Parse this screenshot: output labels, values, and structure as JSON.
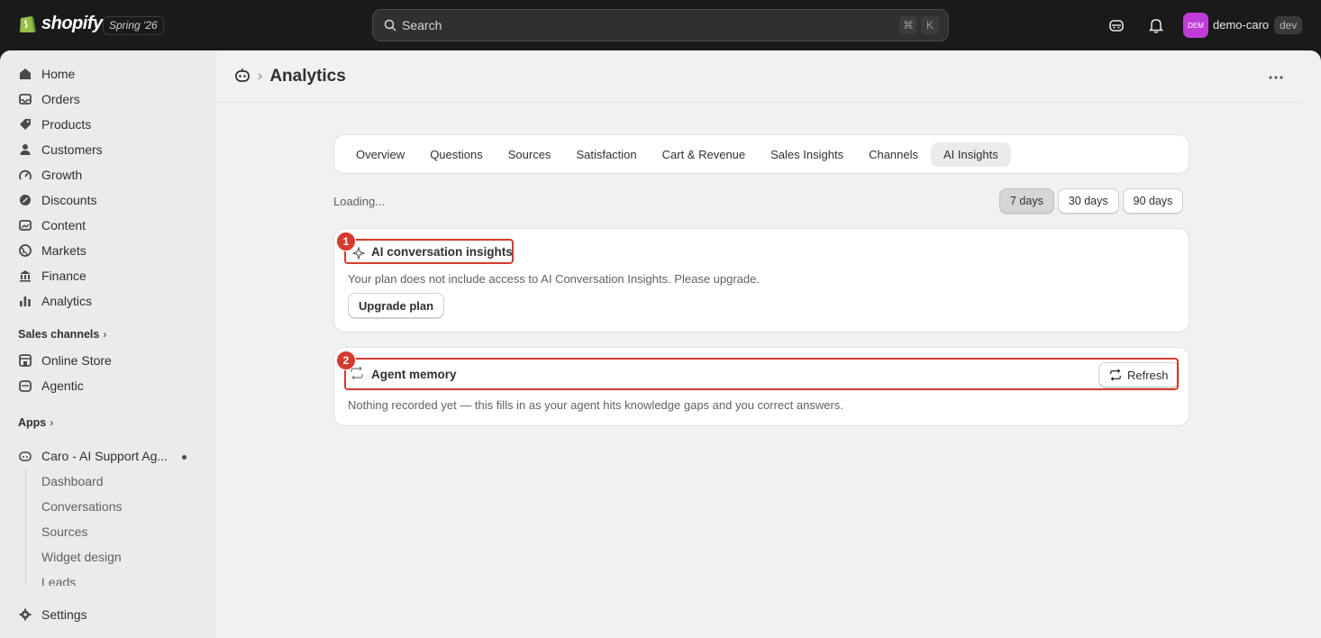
{
  "topbar": {
    "brand": "shopify",
    "edition": "Spring '26",
    "search_placeholder": "Search",
    "shortcut_keys": [
      "⌘",
      "K"
    ],
    "avatar_initials": "DEM",
    "store_name": "demo-caro",
    "env_badge": "dev",
    "colors": {
      "avatar": "#c13cd6"
    }
  },
  "sidebar": {
    "items": [
      {
        "label": "Home",
        "icon": "home-icon"
      },
      {
        "label": "Orders",
        "icon": "inbox-icon"
      },
      {
        "label": "Products",
        "icon": "tag-icon"
      },
      {
        "label": "Customers",
        "icon": "person-icon"
      },
      {
        "label": "Growth",
        "icon": "gauge-icon"
      },
      {
        "label": "Discounts",
        "icon": "discount-icon"
      },
      {
        "label": "Content",
        "icon": "image-icon"
      },
      {
        "label": "Markets",
        "icon": "globe-icon"
      },
      {
        "label": "Finance",
        "icon": "bank-icon"
      },
      {
        "label": "Analytics",
        "icon": "bar-chart-icon"
      }
    ],
    "sales_channels_heading": "Sales channels",
    "channels": [
      {
        "label": "Online Store",
        "icon": "store-icon"
      },
      {
        "label": "Agentic",
        "icon": "agent-icon"
      }
    ],
    "apps_heading": "Apps",
    "app": {
      "label": "Caro - AI Support Ag...",
      "icon": "robot-icon"
    },
    "app_subitems": [
      "Dashboard",
      "Conversations",
      "Sources",
      "Widget design",
      "Leads"
    ],
    "settings_label": "Settings"
  },
  "page": {
    "title": "Analytics",
    "tabs": [
      "Overview",
      "Questions",
      "Sources",
      "Satisfaction",
      "Cart & Revenue",
      "Sales Insights",
      "Channels",
      "AI Insights"
    ],
    "active_tab": "AI Insights",
    "loading_text": "Loading...",
    "ranges": [
      "7 days",
      "30 days",
      "90 days"
    ],
    "active_range": "7 days"
  },
  "cards": {
    "insights": {
      "title": "AI conversation insights",
      "message": "Your plan does not include access to AI Conversation Insights. Please upgrade.",
      "button": "Upgrade plan"
    },
    "memory": {
      "title": "Agent memory",
      "message": "Nothing recorded yet — this fills in as your agent hits knowledge gaps and you correct answers.",
      "button": "Refresh"
    }
  },
  "annotations": {
    "markers": [
      "1",
      "2"
    ],
    "color": "#d43b2e"
  }
}
